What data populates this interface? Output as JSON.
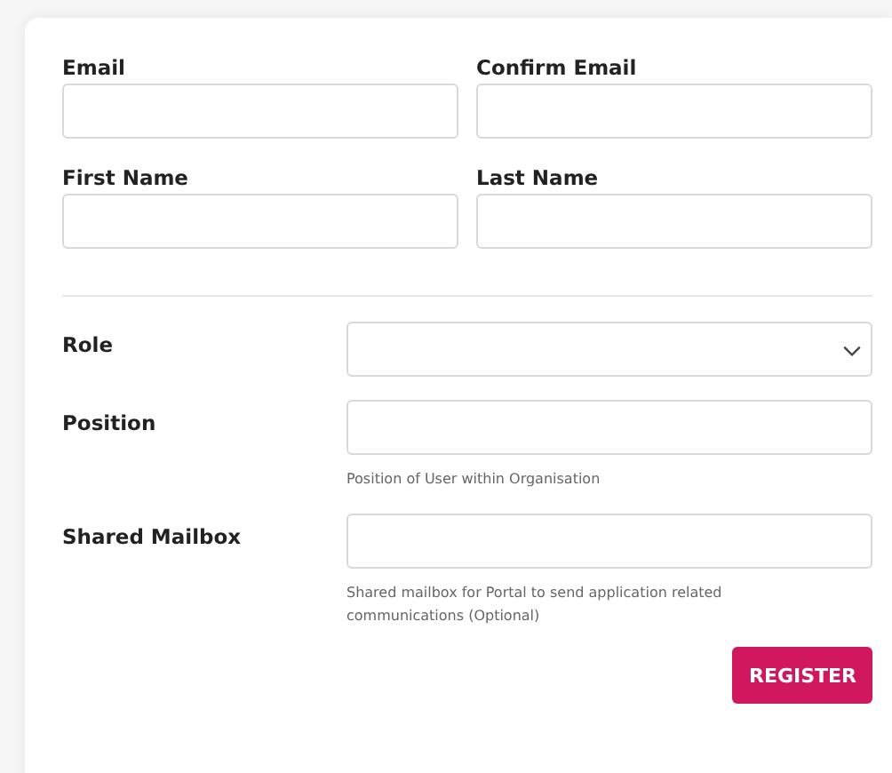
{
  "top_fields": [
    {
      "label": "Email"
    },
    {
      "label": "Confirm Email"
    },
    {
      "label": "First Name"
    },
    {
      "label": "Last Name"
    }
  ],
  "detail_fields": [
    {
      "label": "Role",
      "kind": "select"
    },
    {
      "label": "Position",
      "kind": "text",
      "help": "Position of User within Organisation"
    },
    {
      "label": "Shared Mailbox",
      "kind": "text",
      "help": "Shared mailbox for Portal to send application related communications (Optional)"
    }
  ],
  "submit": {
    "label": "REGISTER"
  }
}
